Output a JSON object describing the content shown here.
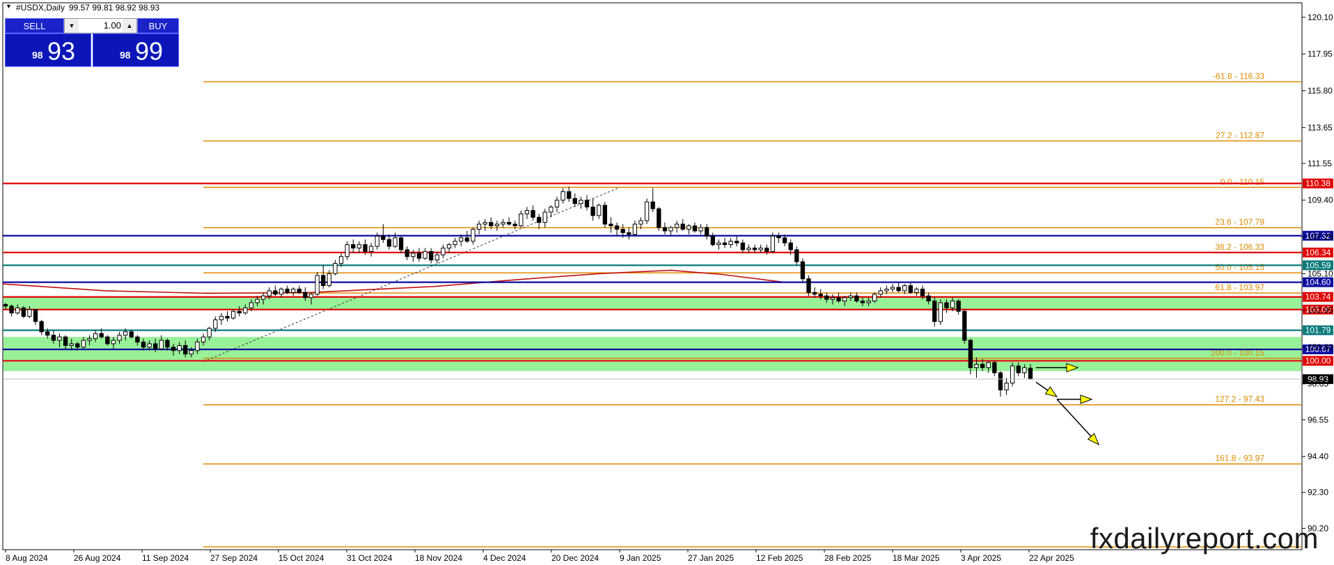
{
  "header": {
    "symbol": "#USDX,Daily",
    "ohlc": "99.57 99.81 98.92 98.93"
  },
  "trade_panel": {
    "sell_label": "SELL",
    "buy_label": "BUY",
    "lot": "1.00",
    "sell_small": "98",
    "sell_big": "93",
    "buy_small": "98",
    "buy_big": "99"
  },
  "brand": "fxdailyreport.com",
  "colors": {
    "candle": "#000000",
    "fib": "#e08a00",
    "red": "#e00000",
    "blue": "#0a0aa0",
    "teal": "#0a7a7a",
    "zone": "#98f098",
    "ma": "#c01010"
  },
  "chart_data": {
    "type": "candlestick",
    "ylim": [
      88.95,
      120.95
    ],
    "y_ticks": [
      120.1,
      117.95,
      115.8,
      113.65,
      111.55,
      109.4,
      107.25,
      105.1,
      102.95,
      100.8,
      98.65,
      96.55,
      94.4,
      92.3,
      90.2
    ],
    "x_ticks": [
      "8 Aug 2024",
      "26 Aug 2024",
      "11 Sep 2024",
      "27 Sep 2024",
      "15 Oct 2024",
      "31 Oct 2024",
      "18 Nov 2024",
      "4 Dec 2024",
      "20 Dec 2024",
      "9 Jan 2025",
      "27 Jan 2025",
      "12 Feb 2025",
      "28 Feb 2025",
      "18 Mar 2025",
      "3 Apr 2025",
      "22 Apr 2025"
    ],
    "fib_levels": [
      {
        "label": "-61.8 - 116.33",
        "value": 116.33
      },
      {
        "label": "27.2 - 112.87",
        "value": 112.87
      },
      {
        "label": "0.0 - 110.15",
        "value": 110.15
      },
      {
        "label": "23.6 - 107.79",
        "value": 107.79
      },
      {
        "label": "38.2 - 106.33",
        "value": 106.33
      },
      {
        "label": "50.0 - 105.15",
        "value": 105.15
      },
      {
        "label": "61.8 - 103.97",
        "value": 103.97
      },
      {
        "label": "100.0 - 100.15",
        "value": 100.15
      },
      {
        "label": "127.2 - 97.43",
        "value": 97.43
      },
      {
        "label": "161.8 - 93.97",
        "value": 93.97
      }
    ],
    "horizontal_levels": [
      {
        "label": "110.38",
        "value": 110.38,
        "color": "red"
      },
      {
        "label": "107.32",
        "value": 107.32,
        "color": "blue"
      },
      {
        "label": "106.34",
        "value": 106.34,
        "color": "red"
      },
      {
        "label": "105.59",
        "value": 105.59,
        "color": "teal"
      },
      {
        "label": "104.60",
        "value": 104.6,
        "color": "blue"
      },
      {
        "label": "103.74",
        "value": 103.74,
        "color": "red"
      },
      {
        "label": "103.00",
        "value": 103.0,
        "color": "red"
      },
      {
        "label": "101.79",
        "value": 101.79,
        "color": "teal"
      },
      {
        "label": "100.67",
        "value": 100.67,
        "color": "blue"
      },
      {
        "label": "100.00",
        "value": 100.0,
        "color": "red"
      }
    ],
    "support_zones": [
      [
        103.0,
        103.74
      ],
      [
        100.0,
        101.4
      ],
      [
        99.4,
        99.95
      ]
    ],
    "current_price": {
      "label": "98.93",
      "value": 98.93
    },
    "moving_average": {
      "x": [
        0,
        0.1,
        0.2,
        0.3,
        0.42,
        0.5,
        0.58,
        0.65,
        0.7,
        0.76
      ],
      "y": [
        104.5,
        104.1,
        103.95,
        104.0,
        104.35,
        104.75,
        105.1,
        105.3,
        105.05,
        104.6
      ]
    },
    "candles": [
      [
        103.3,
        103.4,
        103.0,
        103.2
      ],
      [
        103.2,
        103.3,
        102.6,
        102.8
      ],
      [
        102.8,
        103.3,
        102.7,
        103.1
      ],
      [
        103.1,
        103.2,
        102.5,
        102.6
      ],
      [
        102.6,
        103.2,
        102.5,
        103.0
      ],
      [
        103.0,
        103.0,
        102.1,
        102.3
      ],
      [
        102.3,
        102.4,
        101.5,
        101.7
      ],
      [
        101.7,
        101.9,
        101.3,
        101.5
      ],
      [
        101.5,
        101.8,
        101.0,
        101.2
      ],
      [
        101.2,
        101.6,
        100.8,
        101.4
      ],
      [
        101.4,
        101.5,
        100.7,
        100.9
      ],
      [
        100.9,
        101.3,
        100.6,
        101.0
      ],
      [
        101.0,
        101.1,
        100.6,
        100.8
      ],
      [
        100.8,
        101.4,
        100.7,
        101.2
      ],
      [
        101.2,
        101.5,
        100.9,
        101.3
      ],
      [
        101.3,
        101.8,
        101.1,
        101.6
      ],
      [
        101.6,
        101.9,
        101.3,
        101.4
      ],
      [
        101.4,
        101.5,
        100.9,
        101.0
      ],
      [
        101.0,
        101.4,
        100.7,
        101.2
      ],
      [
        101.2,
        101.7,
        101.0,
        101.5
      ],
      [
        101.5,
        101.9,
        101.2,
        101.7
      ],
      [
        101.7,
        101.8,
        101.3,
        101.4
      ],
      [
        101.4,
        101.5,
        100.9,
        101.1
      ],
      [
        101.1,
        101.3,
        100.6,
        100.8
      ],
      [
        100.8,
        101.2,
        100.6,
        101.0
      ],
      [
        101.0,
        101.3,
        100.5,
        100.7
      ],
      [
        100.7,
        101.5,
        100.6,
        101.2
      ],
      [
        101.2,
        101.3,
        100.6,
        100.8
      ],
      [
        100.8,
        101.0,
        100.3,
        100.6
      ],
      [
        100.6,
        101.1,
        100.4,
        100.9
      ],
      [
        100.9,
        101.2,
        100.2,
        100.4
      ],
      [
        100.4,
        100.8,
        100.2,
        100.6
      ],
      [
        100.6,
        101.3,
        100.4,
        101.1
      ],
      [
        101.1,
        101.6,
        100.9,
        101.4
      ],
      [
        101.4,
        102.0,
        101.2,
        101.9
      ],
      [
        101.9,
        102.6,
        101.7,
        102.4
      ],
      [
        102.4,
        102.8,
        102.1,
        102.6
      ],
      [
        102.6,
        102.9,
        102.3,
        102.5
      ],
      [
        102.5,
        103.0,
        102.4,
        102.9
      ],
      [
        102.9,
        103.2,
        102.6,
        102.8
      ],
      [
        102.8,
        103.3,
        102.7,
        103.1
      ],
      [
        103.1,
        103.6,
        102.9,
        103.4
      ],
      [
        103.4,
        103.8,
        103.2,
        103.6
      ],
      [
        103.6,
        104.0,
        103.3,
        103.8
      ],
      [
        103.8,
        104.3,
        103.6,
        104.1
      ],
      [
        104.1,
        104.4,
        103.8,
        103.9
      ],
      [
        103.9,
        104.3,
        103.7,
        104.2
      ],
      [
        104.2,
        104.4,
        103.9,
        104.0
      ],
      [
        104.0,
        104.3,
        103.8,
        104.2
      ],
      [
        104.2,
        104.4,
        103.9,
        104.0
      ],
      [
        104.0,
        104.3,
        103.5,
        103.7
      ],
      [
        103.7,
        104.0,
        103.3,
        103.9
      ],
      [
        103.9,
        105.2,
        103.8,
        105.0
      ],
      [
        105.0,
        105.6,
        104.2,
        104.4
      ],
      [
        104.4,
        105.3,
        104.3,
        105.1
      ],
      [
        105.1,
        105.9,
        105.0,
        105.7
      ],
      [
        105.7,
        106.3,
        105.5,
        106.1
      ],
      [
        106.1,
        107.0,
        105.9,
        106.8
      ],
      [
        106.8,
        107.1,
        106.3,
        106.6
      ],
      [
        106.6,
        107.0,
        106.3,
        106.8
      ],
      [
        106.8,
        107.1,
        106.2,
        106.4
      ],
      [
        106.4,
        106.9,
        106.1,
        106.7
      ],
      [
        106.7,
        107.5,
        106.5,
        107.3
      ],
      [
        107.3,
        108.0,
        106.9,
        107.1
      ],
      [
        107.1,
        107.4,
        106.5,
        106.7
      ],
      [
        106.7,
        107.5,
        106.6,
        107.2
      ],
      [
        107.2,
        107.3,
        106.3,
        106.5
      ],
      [
        106.5,
        106.7,
        105.9,
        106.1
      ],
      [
        106.1,
        106.5,
        105.8,
        106.3
      ],
      [
        106.3,
        106.6,
        105.8,
        106.0
      ],
      [
        106.0,
        106.6,
        105.9,
        106.4
      ],
      [
        106.4,
        106.6,
        105.7,
        105.9
      ],
      [
        105.9,
        106.4,
        105.7,
        106.2
      ],
      [
        106.2,
        106.8,
        106.0,
        106.6
      ],
      [
        106.6,
        106.9,
        106.3,
        106.8
      ],
      [
        106.8,
        107.2,
        106.6,
        107.0
      ],
      [
        107.0,
        107.4,
        106.7,
        107.2
      ],
      [
        107.2,
        107.6,
        106.9,
        107.0
      ],
      [
        107.0,
        107.8,
        106.8,
        107.7
      ],
      [
        107.7,
        108.2,
        107.4,
        108.0
      ],
      [
        108.0,
        108.3,
        107.6,
        108.1
      ],
      [
        108.1,
        108.4,
        107.7,
        107.9
      ],
      [
        107.9,
        108.2,
        107.6,
        108.0
      ],
      [
        108.0,
        108.3,
        107.8,
        108.1
      ],
      [
        108.1,
        108.4,
        107.9,
        108.0
      ],
      [
        108.0,
        108.2,
        107.7,
        107.9
      ],
      [
        107.9,
        108.8,
        107.8,
        108.6
      ],
      [
        108.6,
        109.0,
        108.3,
        108.8
      ],
      [
        108.8,
        109.1,
        108.2,
        108.4
      ],
      [
        108.4,
        108.6,
        107.7,
        108.1
      ],
      [
        108.1,
        108.9,
        107.8,
        108.7
      ],
      [
        108.7,
        109.1,
        108.4,
        109.0
      ],
      [
        109.0,
        109.6,
        108.7,
        109.4
      ],
      [
        109.4,
        110.1,
        109.2,
        109.9
      ],
      [
        109.9,
        110.2,
        109.3,
        109.5
      ],
      [
        109.5,
        109.8,
        109.0,
        109.2
      ],
      [
        109.2,
        109.6,
        108.9,
        109.4
      ],
      [
        109.4,
        109.7,
        108.8,
        109.0
      ],
      [
        109.0,
        109.5,
        108.2,
        108.5
      ],
      [
        108.5,
        109.2,
        108.3,
        109.1
      ],
      [
        109.1,
        109.3,
        107.8,
        108.0
      ],
      [
        108.0,
        108.4,
        107.5,
        107.9
      ],
      [
        107.9,
        108.1,
        107.3,
        107.7
      ],
      [
        107.7,
        108.0,
        107.2,
        107.5
      ],
      [
        107.5,
        107.8,
        107.1,
        107.4
      ],
      [
        107.4,
        108.2,
        107.3,
        108.0
      ],
      [
        108.0,
        108.4,
        107.7,
        108.2
      ],
      [
        108.2,
        109.5,
        108.0,
        109.3
      ],
      [
        109.3,
        110.1,
        108.7,
        108.9
      ],
      [
        108.9,
        109.0,
        107.6,
        107.8
      ],
      [
        107.8,
        108.1,
        107.4,
        107.6
      ],
      [
        107.6,
        107.9,
        107.3,
        107.8
      ],
      [
        107.8,
        108.2,
        107.5,
        108.0
      ],
      [
        108.0,
        108.3,
        107.6,
        107.7
      ],
      [
        107.7,
        108.0,
        107.4,
        107.9
      ],
      [
        107.9,
        108.1,
        107.5,
        107.6
      ],
      [
        107.6,
        108.0,
        107.4,
        107.8
      ],
      [
        107.8,
        108.0,
        107.1,
        107.3
      ],
      [
        107.3,
        107.5,
        106.7,
        106.8
      ],
      [
        106.8,
        107.1,
        106.5,
        106.9
      ],
      [
        106.9,
        107.2,
        106.6,
        106.8
      ],
      [
        106.8,
        107.2,
        106.6,
        107.0
      ],
      [
        107.0,
        107.3,
        106.7,
        106.9
      ],
      [
        106.9,
        107.1,
        106.3,
        106.5
      ],
      [
        106.5,
        106.8,
        106.3,
        106.6
      ],
      [
        106.6,
        106.8,
        106.3,
        106.5
      ],
      [
        106.5,
        106.8,
        106.3,
        106.6
      ],
      [
        106.6,
        106.8,
        106.2,
        106.4
      ],
      [
        106.4,
        107.5,
        106.3,
        107.3
      ],
      [
        107.3,
        107.5,
        106.9,
        107.2
      ],
      [
        107.2,
        107.4,
        106.7,
        106.9
      ],
      [
        106.9,
        107.1,
        106.2,
        106.5
      ],
      [
        106.5,
        106.7,
        105.6,
        105.8
      ],
      [
        105.8,
        106.0,
        104.6,
        104.8
      ],
      [
        104.8,
        105.0,
        103.8,
        104.0
      ],
      [
        104.0,
        104.3,
        103.7,
        103.9
      ],
      [
        103.9,
        104.2,
        103.6,
        103.8
      ],
      [
        103.8,
        104.0,
        103.4,
        103.6
      ],
      [
        103.6,
        103.9,
        103.3,
        103.7
      ],
      [
        103.7,
        104.0,
        103.4,
        103.5
      ],
      [
        103.5,
        103.8,
        103.2,
        103.7
      ],
      [
        103.7,
        104.0,
        103.5,
        103.8
      ],
      [
        103.8,
        104.0,
        103.4,
        103.5
      ],
      [
        103.5,
        103.7,
        103.2,
        103.4
      ],
      [
        103.4,
        103.7,
        103.2,
        103.5
      ],
      [
        103.5,
        104.0,
        103.4,
        103.9
      ],
      [
        103.9,
        104.3,
        103.7,
        104.1
      ],
      [
        104.1,
        104.4,
        103.9,
        104.2
      ],
      [
        104.2,
        104.5,
        104.0,
        104.3
      ],
      [
        104.3,
        104.6,
        104.0,
        104.1
      ],
      [
        104.1,
        104.5,
        103.9,
        104.4
      ],
      [
        104.4,
        104.6,
        103.9,
        104.0
      ],
      [
        104.0,
        104.3,
        103.8,
        104.2
      ],
      [
        104.2,
        104.4,
        103.6,
        103.8
      ],
      [
        103.8,
        104.0,
        103.3,
        103.5
      ],
      [
        103.5,
        103.7,
        102.0,
        102.3
      ],
      [
        102.3,
        103.6,
        102.1,
        103.4
      ],
      [
        103.4,
        103.6,
        102.8,
        103.1
      ],
      [
        103.1,
        103.7,
        102.9,
        103.5
      ],
      [
        103.5,
        103.6,
        102.7,
        102.9
      ],
      [
        102.9,
        103.0,
        101.0,
        101.2
      ],
      [
        101.2,
        101.3,
        99.2,
        99.6
      ],
      [
        99.6,
        100.2,
        99.0,
        99.8
      ],
      [
        99.8,
        100.1,
        99.4,
        99.6
      ],
      [
        99.6,
        100.0,
        99.3,
        99.9
      ],
      [
        99.9,
        100.0,
        99.1,
        99.3
      ],
      [
        99.3,
        99.4,
        97.9,
        98.3
      ],
      [
        98.3,
        99.0,
        98.0,
        98.7
      ],
      [
        98.7,
        99.9,
        98.5,
        99.7
      ],
      [
        99.7,
        99.9,
        99.1,
        99.3
      ],
      [
        99.3,
        99.8,
        99.0,
        99.6
      ],
      [
        99.57,
        99.81,
        98.92,
        98.93
      ]
    ],
    "projection_arrows": [
      [
        [
          0,
          99.6
        ],
        [
          0.06,
          99.6
        ]
      ],
      [
        [
          0,
          98.75
        ],
        [
          0.03,
          97.9
        ]
      ],
      [
        [
          0.03,
          97.75
        ],
        [
          0.08,
          97.75
        ]
      ],
      [
        [
          0.03,
          97.75
        ],
        [
          0.09,
          95.1
        ]
      ]
    ]
  }
}
